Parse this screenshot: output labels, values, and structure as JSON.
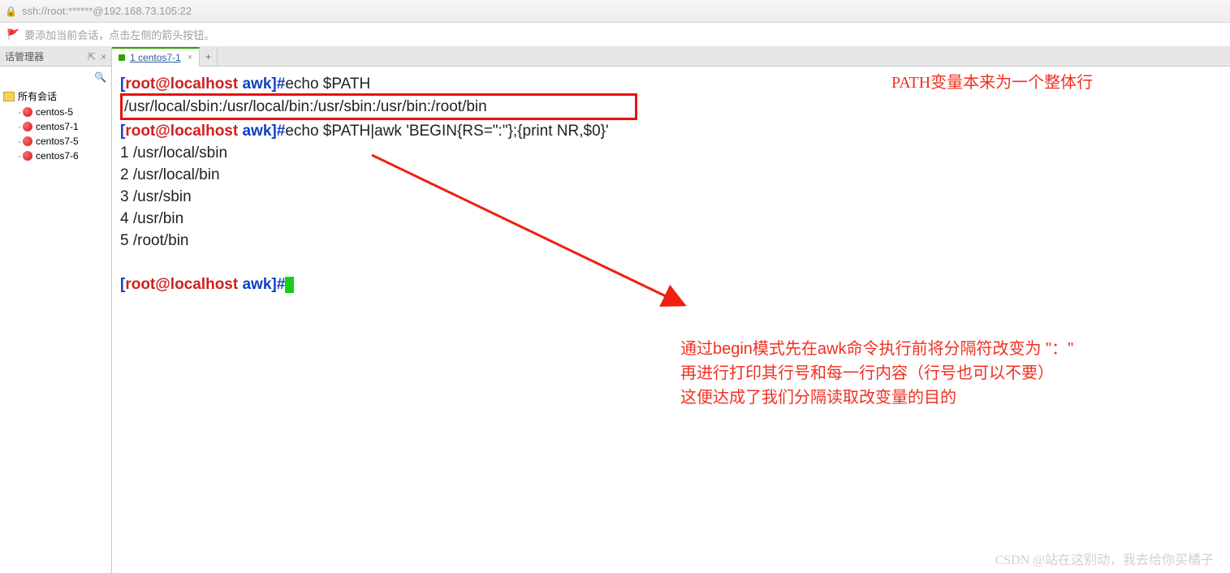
{
  "titlebar": {
    "text": "ssh://root:******@192.168.73.105:22"
  },
  "infobar": {
    "text": "要添加当前会话，点击左侧的箭头按钮。"
  },
  "panel": {
    "title": "话管理器",
    "pin": "⇱",
    "close": "×"
  },
  "tab": {
    "label": "1 centos7-1",
    "close": "×",
    "add": "+"
  },
  "sidebar": {
    "root": "所有会话",
    "items": [
      "centos-5",
      "centos7-1",
      "centos7-5",
      "centos7-6"
    ],
    "search": "🔍"
  },
  "terminal": {
    "p_open": "[",
    "p_user": "root@localhost",
    "p_path": " awk",
    "p_close": "]#",
    "cmd1": "echo $PATH",
    "out1": "/usr/local/sbin:/usr/local/bin:/usr/sbin:/usr/bin:/root/bin",
    "cmd2": "echo $PATH|awk 'BEGIN{RS=\":\"};{print NR,$0}'",
    "lines": [
      "1 /usr/local/sbin",
      "2 /usr/local/bin",
      "3 /usr/sbin",
      "4 /usr/bin",
      "5 /root/bin"
    ]
  },
  "annotations": {
    "top": "PATH变量本来为一个整体行",
    "bottom1": "通过begin模式先在awk命令执行前将分隔符改变为 \"：\"",
    "bottom2": "再进行打印其行号和每一行内容（行号也可以不要）",
    "bottom3": "这便达成了我们分隔读取改变量的目的"
  },
  "watermark": "CSDN @站在这别动，我去给你买橘子"
}
